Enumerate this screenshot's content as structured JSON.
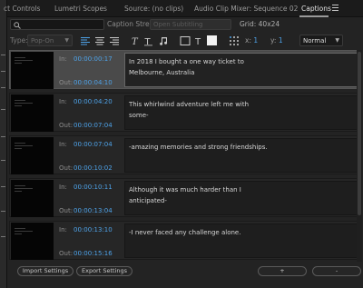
{
  "tabs": [
    {
      "label": "ct Controls"
    },
    {
      "label": "Lumetri Scopes"
    },
    {
      "label": "Source: (no clips)"
    },
    {
      "label": "Audio Clip Mixer: Sequence 02"
    },
    {
      "label": "Captions"
    }
  ],
  "search": {
    "value": "",
    "placeholder": ""
  },
  "caption_stream": {
    "label": "Caption Stream:",
    "value": "Open Subtitling"
  },
  "grid": {
    "label": "Grid: 40x24"
  },
  "toolbar": {
    "type_label": "Type:",
    "type_value": "Pop-On",
    "x_label": "x:",
    "x_value": "1",
    "y_label": "y:",
    "y_value": "1",
    "style_value": "Normal",
    "icons": [
      "align-left-icon",
      "align-center-icon",
      "align-right-icon",
      "italic-icon",
      "text-icon",
      "music-note-icon",
      "fill-box-icon",
      "text-color-icon",
      "grid-position-icon"
    ]
  },
  "captions": [
    {
      "in_label": "In:",
      "in": "00:00:00:17",
      "out_label": "Out:",
      "out": "00:00:04:10",
      "lines": [
        "In 2018 I bought a one way ticket to",
        "Melbourne, Australia"
      ],
      "selected": true
    },
    {
      "in_label": "In:",
      "in": "00:00:04:20",
      "out_label": "Out:",
      "out": "00:00:07:04",
      "lines": [
        "This whirlwind adventure left me with",
        "some-"
      ],
      "selected": false
    },
    {
      "in_label": "In:",
      "in": "00:00:07:04",
      "out_label": "Out:",
      "out": "00:00:10:02",
      "lines": [
        "-amazing memories and strong friendships.",
        ""
      ],
      "selected": false
    },
    {
      "in_label": "In:",
      "in": "00:00:10:11",
      "out_label": "Out:",
      "out": "00:00:13:04",
      "lines": [
        "Although it was much harder than I",
        "anticipated-"
      ],
      "selected": false
    },
    {
      "in_label": "In:",
      "in": "00:00:13:10",
      "out_label": "Out:",
      "out": "00:00:15:16",
      "lines": [
        "-I never faced any challenge alone.",
        ""
      ],
      "selected": false
    }
  ],
  "buttons": {
    "import": "Import Settings",
    "export": "Export Settings",
    "add": "+",
    "remove": "-"
  },
  "colors": {
    "accent": "#4ea2e8",
    "panel": "#232323",
    "selected_row": "#4a4a4a",
    "swatch": "#f2f2f2"
  }
}
